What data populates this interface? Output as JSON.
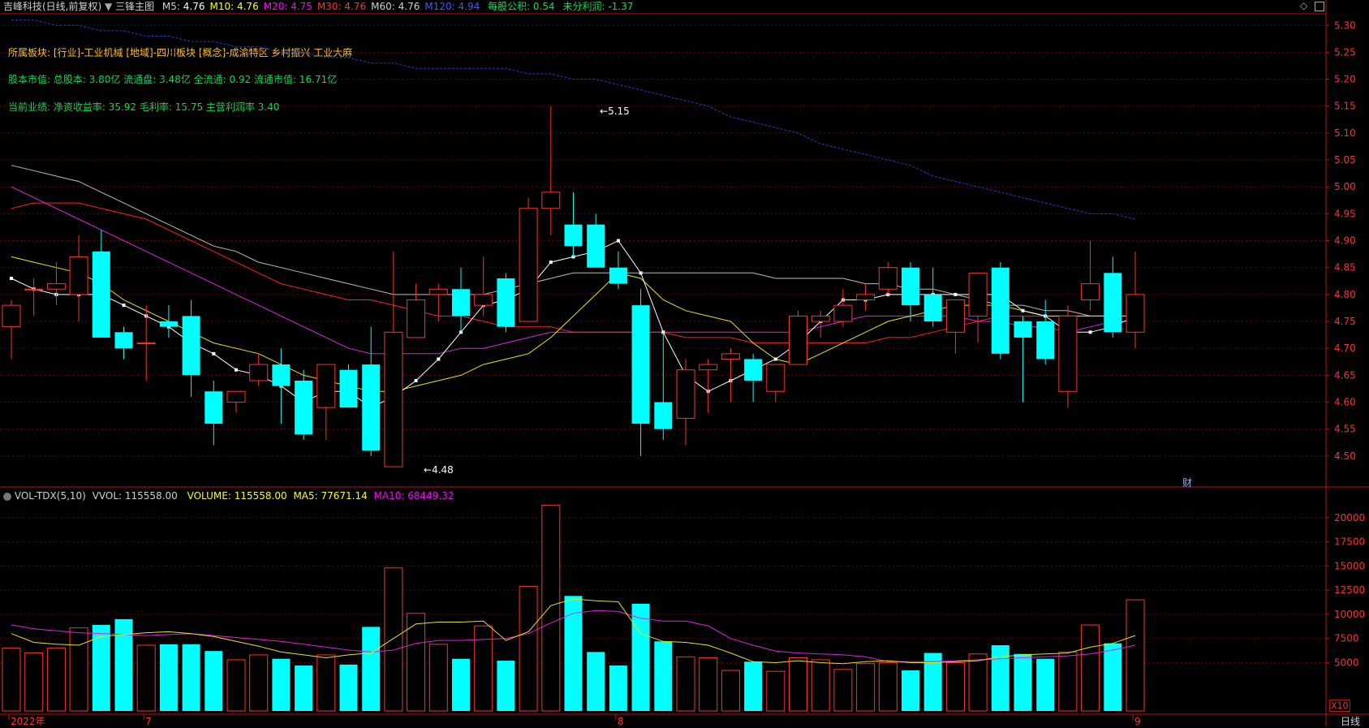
{
  "header": {
    "title": "吉峰科技(日线,前复权)",
    "indicator": "三锋主图",
    "ma": [
      {
        "label": "M5:",
        "value": "4.76",
        "color": "#ffffff"
      },
      {
        "label": "M10:",
        "value": "4.76",
        "color": "#ffff00"
      },
      {
        "label": "M20:",
        "value": "4.75",
        "color": "#ff00ff"
      },
      {
        "label": "M30:",
        "value": "4.76",
        "color": "#ff3030"
      },
      {
        "label": "M60:",
        "value": "4.76",
        "color": "#d0d0d0"
      },
      {
        "label": "M120:",
        "value": "4.94",
        "color": "#3a5aff"
      }
    ],
    "eps": "每股公积: 0.54",
    "undist": "未分利润: -1.37"
  },
  "info": {
    "sector": "所属板块: [行业]-工业机械 [地域]-四川板块 [概念]-成渝特区 乡村振兴 工业大麻",
    "capital": "股本市值: 总股本: 3.80亿 流通盘: 3.48亿 全流通: 0.92 流通市值: 16.71亿",
    "perf": "当前业绩:  净资收益率: 35.92 毛利率: 15.75 主营利润率 3.40"
  },
  "annotations": {
    "high": "5.15",
    "low": "4.48",
    "finance_marker": "财"
  },
  "price_axis": [
    "5.30",
    "5.25",
    "5.20",
    "5.15",
    "5.10",
    "5.05",
    "5.00",
    "4.95",
    "4.90",
    "4.85",
    "4.80",
    "4.75",
    "4.70",
    "4.65",
    "4.60",
    "4.55",
    "4.50"
  ],
  "volume_header": {
    "name": "VOL-TDX(5,10)",
    "vvol": "VVOL: 115558.00",
    "volume": "VOLUME: 115558.00",
    "ma5": "MA5: 77671.14",
    "ma10": "MA10: 68449.32"
  },
  "volume_axis": [
    "20000",
    "17500",
    "15000",
    "12500",
    "10000",
    "7500",
    "5000"
  ],
  "volume_unit": "X10",
  "date_axis": [
    {
      "label": "2022年",
      "index": 0
    },
    {
      "label": "7",
      "index": 6
    },
    {
      "label": "8",
      "index": 27
    },
    {
      "label": "9",
      "index": 50
    }
  ],
  "period_label": "日线",
  "colors": {
    "up": "#ff3030",
    "down": "#00ffff",
    "grid": "#6a0000",
    "axis": "#c01010"
  },
  "chart_data": {
    "type": "candlestick",
    "ylim": [
      4.45,
      5.32
    ],
    "volume_ylim": [
      0,
      21500
    ],
    "candles": [
      {
        "o": 4.74,
        "h": 4.79,
        "l": 4.68,
        "c": 4.78,
        "v": 6500
      },
      {
        "o": 4.81,
        "h": 4.83,
        "l": 4.76,
        "c": 4.81,
        "v": 6000
      },
      {
        "o": 4.81,
        "h": 4.86,
        "l": 4.78,
        "c": 4.82,
        "v": 6500
      },
      {
        "o": 4.8,
        "h": 4.91,
        "l": 4.75,
        "c": 4.87,
        "v": 8600
      },
      {
        "o": 4.88,
        "h": 4.92,
        "l": 4.72,
        "c": 4.72,
        "v": 8900
      },
      {
        "o": 4.73,
        "h": 4.74,
        "l": 4.68,
        "c": 4.7,
        "v": 9500
      },
      {
        "o": 4.71,
        "h": 4.78,
        "l": 4.64,
        "c": 4.71,
        "v": 6800
      },
      {
        "o": 4.75,
        "h": 4.78,
        "l": 4.72,
        "c": 4.74,
        "v": 6900
      },
      {
        "o": 4.76,
        "h": 4.79,
        "l": 4.61,
        "c": 4.65,
        "v": 6900
      },
      {
        "o": 4.62,
        "h": 4.64,
        "l": 4.52,
        "c": 4.56,
        "v": 6200
      },
      {
        "o": 4.6,
        "h": 4.62,
        "l": 4.58,
        "c": 4.62,
        "v": 5300
      },
      {
        "o": 4.64,
        "h": 4.69,
        "l": 4.63,
        "c": 4.67,
        "v": 5800
      },
      {
        "o": 4.67,
        "h": 4.7,
        "l": 4.56,
        "c": 4.63,
        "v": 5400
      },
      {
        "o": 4.64,
        "h": 4.66,
        "l": 4.53,
        "c": 4.54,
        "v": 4700
      },
      {
        "o": 4.59,
        "h": 4.67,
        "l": 4.53,
        "c": 4.67,
        "v": 5800
      },
      {
        "o": 4.66,
        "h": 4.67,
        "l": 4.6,
        "c": 4.59,
        "v": 4800
      },
      {
        "o": 4.67,
        "h": 4.74,
        "l": 4.5,
        "c": 4.51,
        "v": 8700
      },
      {
        "o": 4.48,
        "h": 4.88,
        "l": 4.48,
        "c": 4.73,
        "v": 14800
      },
      {
        "o": 4.72,
        "h": 4.82,
        "l": 4.72,
        "c": 4.79,
        "v": 10100
      },
      {
        "o": 4.8,
        "h": 4.82,
        "l": 4.75,
        "c": 4.81,
        "v": 6900
      },
      {
        "o": 4.81,
        "h": 4.85,
        "l": 4.73,
        "c": 4.76,
        "v": 5400
      },
      {
        "o": 4.78,
        "h": 4.87,
        "l": 4.76,
        "c": 4.8,
        "v": 8800
      },
      {
        "o": 4.83,
        "h": 4.84,
        "l": 4.73,
        "c": 4.74,
        "v": 5200
      },
      {
        "o": 4.75,
        "h": 4.98,
        "l": 4.75,
        "c": 4.96,
        "v": 12900
      },
      {
        "o": 4.96,
        "h": 5.15,
        "l": 4.91,
        "c": 4.99,
        "v": 21300
      },
      {
        "o": 4.93,
        "h": 4.99,
        "l": 4.87,
        "c": 4.89,
        "v": 11900
      },
      {
        "o": 4.93,
        "h": 4.95,
        "l": 4.85,
        "c": 4.85,
        "v": 6100
      },
      {
        "o": 4.85,
        "h": 4.88,
        "l": 4.81,
        "c": 4.82,
        "v": 4700
      },
      {
        "o": 4.78,
        "h": 4.81,
        "l": 4.5,
        "c": 4.56,
        "v": 11100
      },
      {
        "o": 4.6,
        "h": 4.73,
        "l": 4.53,
        "c": 4.55,
        "v": 7200
      },
      {
        "o": 4.57,
        "h": 4.68,
        "l": 4.52,
        "c": 4.66,
        "v": 5600
      },
      {
        "o": 4.66,
        "h": 4.68,
        "l": 4.58,
        "c": 4.67,
        "v": 5500
      },
      {
        "o": 4.68,
        "h": 4.7,
        "l": 4.6,
        "c": 4.69,
        "v": 4200
      },
      {
        "o": 4.68,
        "h": 4.69,
        "l": 4.6,
        "c": 4.64,
        "v": 5100
      },
      {
        "o": 4.62,
        "h": 4.67,
        "l": 4.6,
        "c": 4.67,
        "v": 4100
      },
      {
        "o": 4.67,
        "h": 4.77,
        "l": 4.67,
        "c": 4.76,
        "v": 5500
      },
      {
        "o": 4.75,
        "h": 4.77,
        "l": 4.72,
        "c": 4.76,
        "v": 5300
      },
      {
        "o": 4.75,
        "h": 4.81,
        "l": 4.74,
        "c": 4.78,
        "v": 4300
      },
      {
        "o": 4.79,
        "h": 4.82,
        "l": 4.77,
        "c": 4.8,
        "v": 4900
      },
      {
        "o": 4.81,
        "h": 4.86,
        "l": 4.8,
        "c": 4.85,
        "v": 5000
      },
      {
        "o": 4.85,
        "h": 4.86,
        "l": 4.75,
        "c": 4.78,
        "v": 4200
      },
      {
        "o": 4.8,
        "h": 4.85,
        "l": 4.74,
        "c": 4.75,
        "v": 6000
      },
      {
        "o": 4.73,
        "h": 4.79,
        "l": 4.69,
        "c": 4.79,
        "v": 5000
      },
      {
        "o": 4.76,
        "h": 4.84,
        "l": 4.71,
        "c": 4.84,
        "v": 5900
      },
      {
        "o": 4.85,
        "h": 4.86,
        "l": 4.68,
        "c": 4.69,
        "v": 6800
      },
      {
        "o": 4.75,
        "h": 4.76,
        "l": 4.6,
        "c": 4.72,
        "v": 5900
      },
      {
        "o": 4.75,
        "h": 4.79,
        "l": 4.67,
        "c": 4.68,
        "v": 5400
      },
      {
        "o": 4.62,
        "h": 4.78,
        "l": 4.59,
        "c": 4.76,
        "v": 6100
      },
      {
        "o": 4.79,
        "h": 4.9,
        "l": 4.77,
        "c": 4.82,
        "v": 8900
      },
      {
        "o": 4.84,
        "h": 4.87,
        "l": 4.72,
        "c": 4.73,
        "v": 7000
      },
      {
        "o": 4.73,
        "h": 4.88,
        "l": 4.7,
        "c": 4.8,
        "v": 11500
      }
    ],
    "ma5": [
      4.83,
      4.81,
      4.8,
      4.8,
      4.8,
      4.78,
      4.76,
      4.74,
      4.71,
      4.69,
      4.66,
      4.65,
      4.63,
      4.6,
      4.62,
      4.62,
      4.59,
      4.61,
      4.64,
      4.68,
      4.73,
      4.78,
      4.79,
      4.81,
      4.86,
      4.87,
      4.88,
      4.9,
      4.84,
      4.73,
      4.65,
      4.62,
      4.64,
      4.66,
      4.68,
      4.71,
      4.75,
      4.79,
      4.79,
      4.8,
      4.8,
      4.8,
      4.8,
      4.8,
      4.8,
      4.77,
      4.76,
      4.73,
      4.73,
      4.74,
      4.76
    ],
    "ma10": [
      4.87,
      4.86,
      4.85,
      4.84,
      4.82,
      4.79,
      4.77,
      4.75,
      4.73,
      4.71,
      4.7,
      4.69,
      4.67,
      4.65,
      4.64,
      4.63,
      4.62,
      4.62,
      4.63,
      4.64,
      4.65,
      4.67,
      4.68,
      4.69,
      4.72,
      4.76,
      4.8,
      4.84,
      4.83,
      4.79,
      4.77,
      4.76,
      4.75,
      4.71,
      4.68,
      4.67,
      4.69,
      4.71,
      4.73,
      4.75,
      4.76,
      4.77,
      4.78,
      4.78,
      4.78,
      4.77,
      4.76,
      4.76,
      4.76,
      4.76,
      4.76
    ],
    "ma20": [
      5.0,
      4.98,
      4.96,
      4.94,
      4.92,
      4.9,
      4.88,
      4.86,
      4.84,
      4.82,
      4.8,
      4.78,
      4.76,
      4.74,
      4.72,
      4.7,
      4.69,
      4.69,
      4.69,
      4.69,
      4.7,
      4.7,
      4.71,
      4.72,
      4.73,
      4.73,
      4.73,
      4.73,
      4.73,
      4.73,
      4.73,
      4.73,
      4.73,
      4.73,
      4.73,
      4.73,
      4.74,
      4.75,
      4.76,
      4.76,
      4.76,
      4.76,
      4.76,
      4.75,
      4.75,
      4.74,
      4.74,
      4.73,
      4.74,
      4.75,
      4.75
    ],
    "ma30": [
      4.96,
      4.97,
      4.97,
      4.97,
      4.96,
      4.95,
      4.94,
      4.92,
      4.9,
      4.88,
      4.86,
      4.84,
      4.82,
      4.81,
      4.8,
      4.79,
      4.79,
      4.78,
      4.77,
      4.76,
      4.76,
      4.75,
      4.74,
      4.74,
      4.74,
      4.73,
      4.73,
      4.73,
      4.73,
      4.73,
      4.72,
      4.72,
      4.72,
      4.71,
      4.71,
      4.71,
      4.71,
      4.71,
      4.71,
      4.72,
      4.72,
      4.73,
      4.74,
      4.75,
      4.76,
      4.76,
      4.76,
      4.76,
      4.76,
      4.76,
      4.76
    ],
    "ma60": [
      5.04,
      5.03,
      5.02,
      5.01,
      4.99,
      4.97,
      4.95,
      4.93,
      4.91,
      4.89,
      4.88,
      4.86,
      4.85,
      4.84,
      4.83,
      4.82,
      4.81,
      4.8,
      4.8,
      4.8,
      4.8,
      4.8,
      4.81,
      4.82,
      4.83,
      4.84,
      4.84,
      4.84,
      4.84,
      4.84,
      4.84,
      4.84,
      4.84,
      4.84,
      4.83,
      4.83,
      4.83,
      4.83,
      4.82,
      4.82,
      4.81,
      4.81,
      4.8,
      4.79,
      4.78,
      4.78,
      4.77,
      4.77,
      4.76,
      4.76,
      4.76
    ],
    "ma120": [
      5.31,
      5.31,
      5.3,
      5.3,
      5.29,
      5.29,
      5.28,
      5.28,
      5.27,
      5.27,
      5.26,
      5.26,
      5.25,
      5.25,
      5.24,
      5.24,
      5.23,
      5.23,
      5.22,
      5.22,
      5.22,
      5.22,
      5.22,
      5.21,
      5.21,
      5.2,
      5.2,
      5.19,
      5.18,
      5.17,
      5.16,
      5.15,
      5.13,
      5.12,
      5.11,
      5.1,
      5.08,
      5.07,
      5.06,
      5.05,
      5.04,
      5.02,
      5.01,
      5.0,
      4.99,
      4.98,
      4.97,
      4.96,
      4.95,
      4.95,
      4.94
    ],
    "vol_ma5": [
      8000,
      7100,
      6900,
      6800,
      7700,
      7900,
      8100,
      8200,
      8000,
      7700,
      7200,
      6700,
      6100,
      5800,
      5500,
      5800,
      6000,
      7500,
      9000,
      9200,
      9200,
      9300,
      7300,
      8200,
      10900,
      11600,
      11400,
      11300,
      8000,
      7200,
      7100,
      6800,
      6000,
      5100,
      5000,
      5200,
      5000,
      4900,
      5100,
      5200,
      5000,
      5000,
      5100,
      5200,
      5600,
      5800,
      5900,
      6000,
      6600,
      7000,
      7800
    ],
    "vol_ma10": [
      8900,
      8500,
      8300,
      8100,
      8000,
      7900,
      7800,
      7900,
      8000,
      7800,
      7600,
      7400,
      7200,
      6900,
      6600,
      6300,
      6100,
      6300,
      7000,
      7300,
      7300,
      7400,
      7500,
      8000,
      9100,
      10100,
      10400,
      10300,
      9600,
      9300,
      9300,
      8800,
      7500,
      6800,
      6200,
      6000,
      5900,
      5800,
      5600,
      5100,
      5100,
      5100,
      5200,
      5300,
      5400,
      5500,
      5600,
      5700,
      5900,
      6300,
      6800
    ]
  }
}
